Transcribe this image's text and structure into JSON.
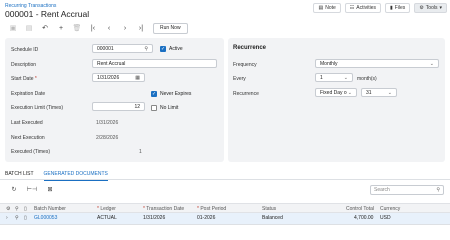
{
  "breadcrumb": "Recurring Transactions",
  "page_title": "000001 - Rent Accrual",
  "top_buttons": {
    "note": "Note",
    "activities": "Activities",
    "files": "Files",
    "tools": "Tools"
  },
  "toolbar": {
    "run_now": "Run Now"
  },
  "form": {
    "schedule_id_label": "Schedule ID",
    "schedule_id_value": "000001",
    "active_label": "Active",
    "description_label": "Description",
    "description_value": "Rent Accrual",
    "start_date_label": "Start Date",
    "start_date_value": "1/31/2026",
    "expiration_date_label": "Expiration Date",
    "never_expires_label": "Never Expires",
    "execution_limit_label": "Execution Limit (Times)",
    "execution_limit_value": "12",
    "no_limit_label": "No Limit",
    "last_executed_label": "Last Executed",
    "last_executed_value": "1/31/2026",
    "next_execution_label": "Next Execution",
    "next_execution_value": "2/28/2026",
    "executed_times_label": "Executed (Times)",
    "executed_times_value": "1"
  },
  "recurrence": {
    "heading": "Recurrence",
    "frequency_label": "Frequency",
    "frequency_value": "Monthly",
    "every_label": "Every",
    "every_value": "1",
    "every_unit": "month(s)",
    "recurrence_label": "Recurrence",
    "recurrence_type": "Fixed Day o",
    "recurrence_day": "31"
  },
  "tabs": [
    "BATCH LIST",
    "GENERATED DOCUMENTS"
  ],
  "grid": {
    "search_placeholder": "Search",
    "columns": [
      "Batch Number",
      "Ledger",
      "Transaction Date",
      "Post Period",
      "Status",
      "Control Total",
      "Currency"
    ],
    "rows": [
      {
        "batch_number": "GL000053",
        "ledger": "ACTUAL",
        "transaction_date": "1/31/2026",
        "post_period": "01-2026",
        "status": "Balanced",
        "control_total": "4,700.00",
        "currency": "USD"
      }
    ]
  }
}
